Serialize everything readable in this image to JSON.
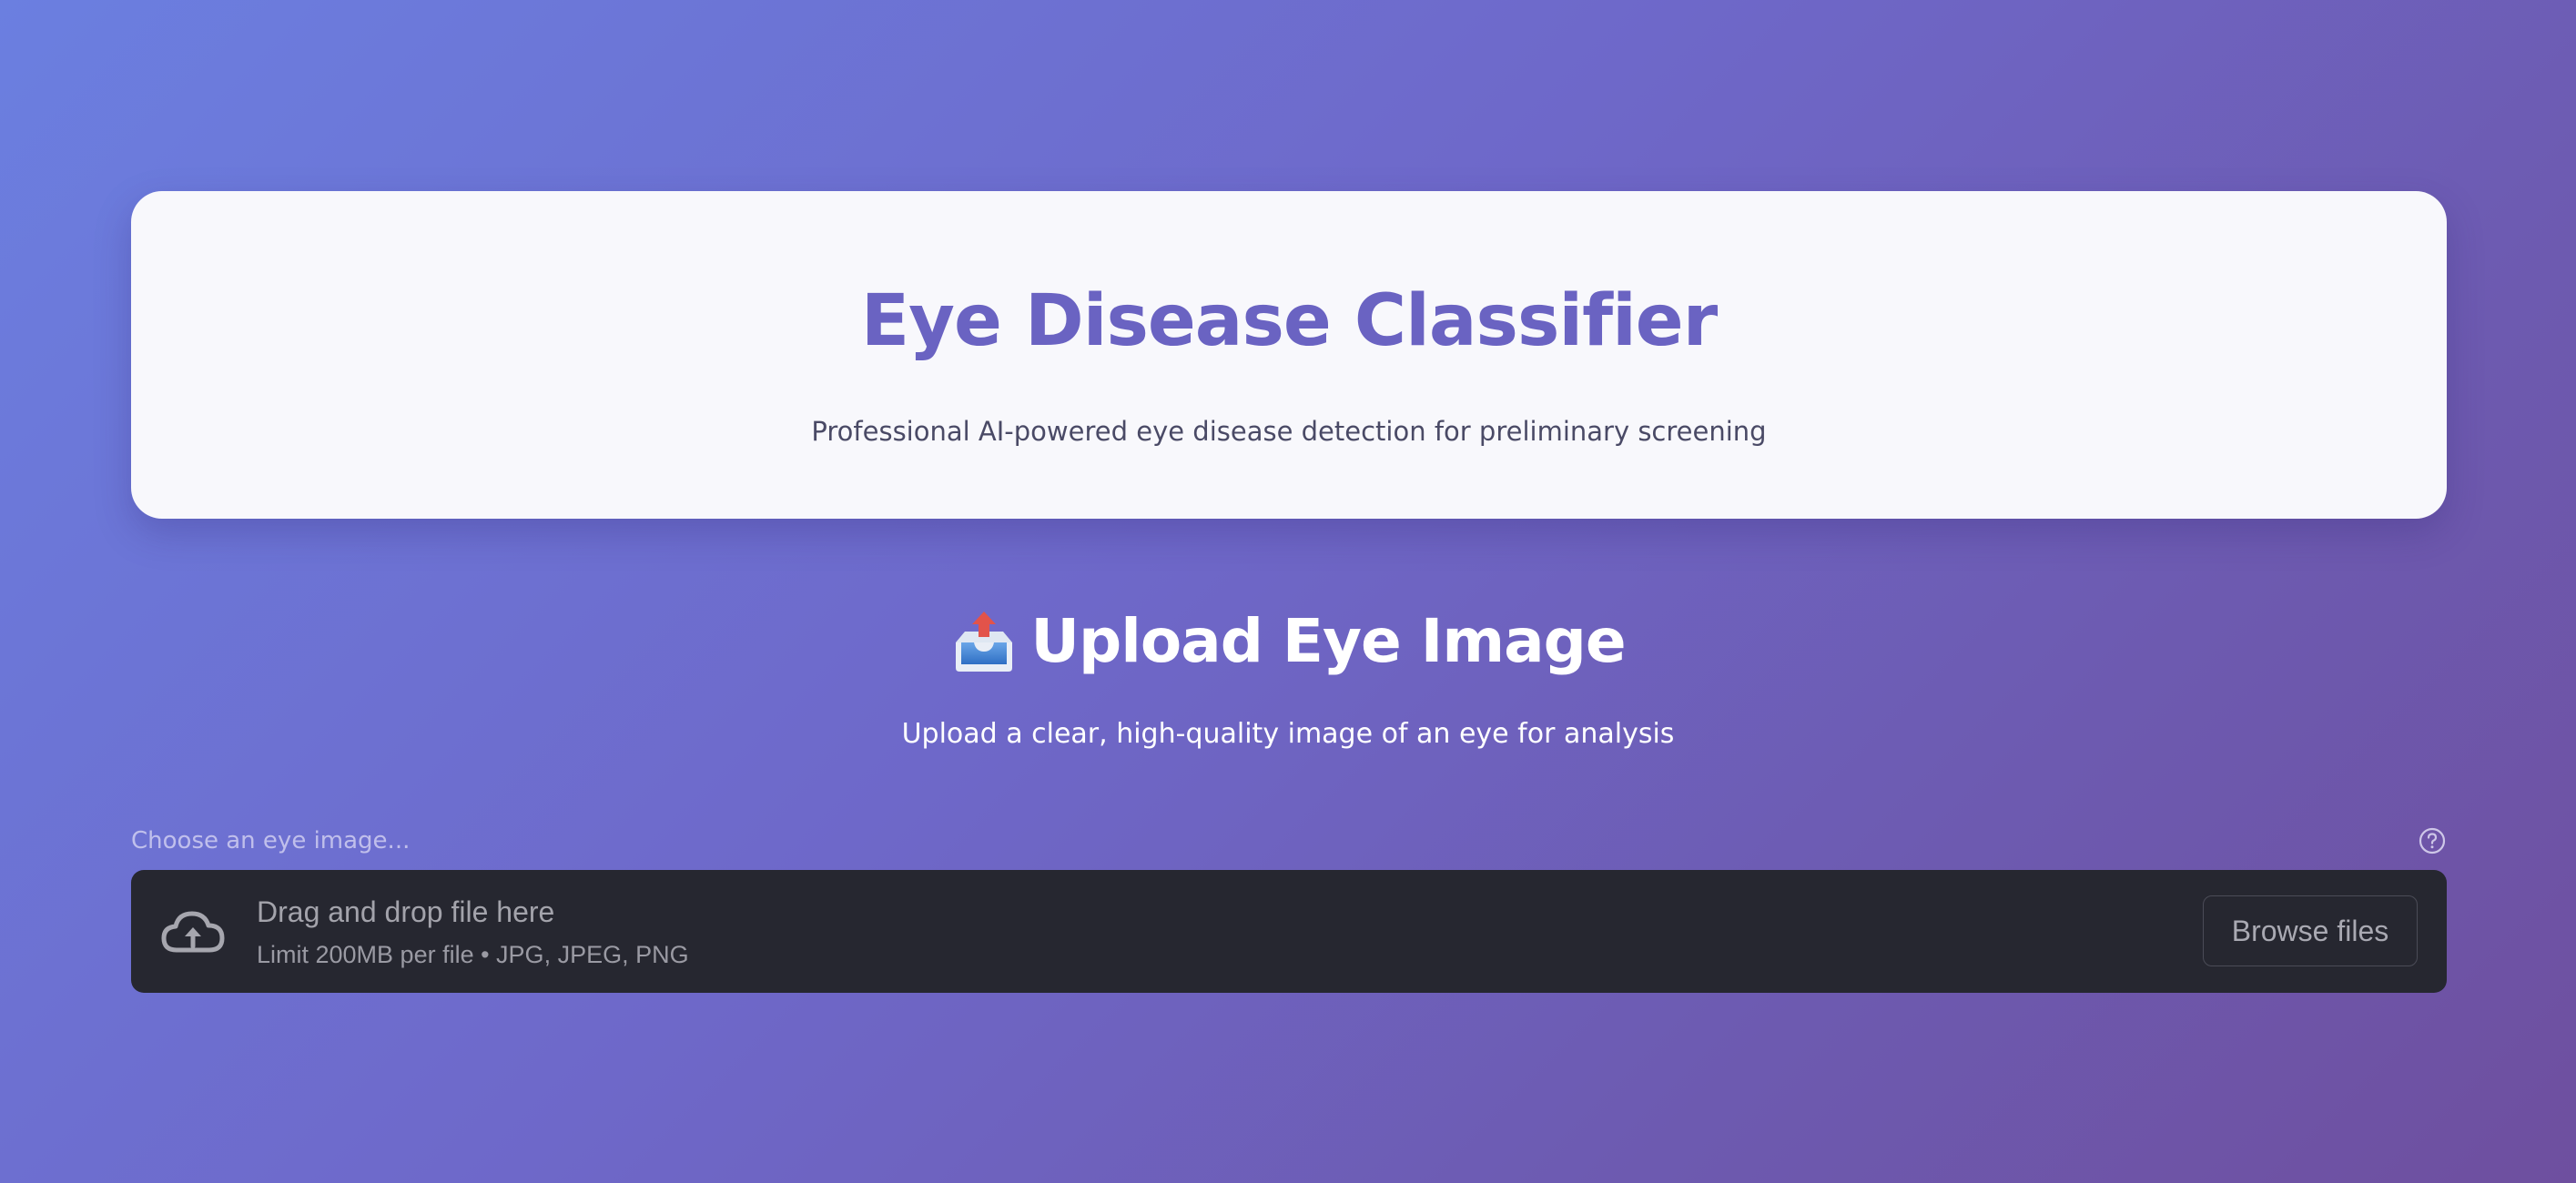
{
  "header": {
    "title": "Eye Disease Classifier",
    "subtitle": "Professional AI-powered eye disease detection for preliminary screening"
  },
  "upload_section": {
    "icon": "inbox-tray-icon",
    "title": "Upload Eye Image",
    "description": "Upload a clear, high-quality image of an eye for analysis"
  },
  "file_uploader": {
    "label": "Choose an eye image...",
    "help_icon": "question-circle-icon",
    "dropzone_icon": "cloud-upload-icon",
    "dropzone_text": "Drag and drop file here",
    "limit_text": "Limit 200MB per file • JPG, JPEG, PNG",
    "browse_label": "Browse files"
  },
  "colors": {
    "background_gradient_start": "#6b7fe0",
    "background_gradient_end": "#6e4f9f",
    "title_color": "#6a63c2",
    "dropzone_bg": "#262730"
  }
}
